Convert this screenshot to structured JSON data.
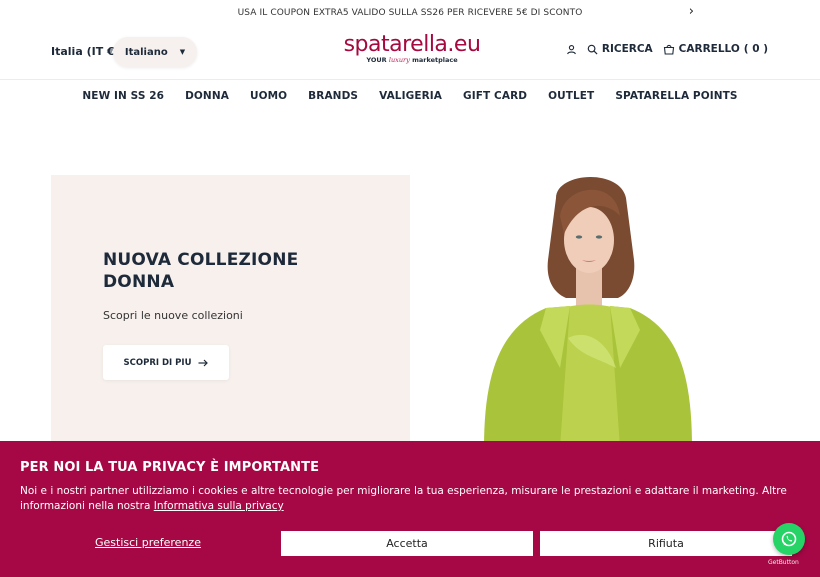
{
  "announcement": {
    "text": "USA IL COUPON EXTRA5 VALIDO SULLA SS26 PER RICEVERE 5€ DI SCONTO"
  },
  "header": {
    "locale": "Italia (IT €)",
    "language": "Italiano",
    "logo_main": "spatarella.eu",
    "logo_sub_prefix": "YOUR",
    "logo_sub_script": "luxury",
    "logo_sub_suffix": "marketplace",
    "search_label": "RICERCA",
    "cart_label": "CARRELLO",
    "cart_count": "( 0 )"
  },
  "nav": {
    "items": [
      "NEW IN SS 26",
      "DONNA",
      "UOMO",
      "BRANDS",
      "VALIGERIA",
      "GIFT CARD",
      "OUTLET",
      "SPATARELLA POINTS"
    ]
  },
  "hero": {
    "title_line1": "NUOVA COLLEZIONE",
    "title_line2": "DONNA",
    "subtitle": "Scopri le nuove collezioni",
    "cta": "SCOPRI DI PIU"
  },
  "cookie": {
    "title": "PER NOI LA TUA PRIVACY È IMPORTANTE",
    "text": "Noi e i nostri partner utilizziamo i cookies e altre tecnologie per migliorare la tua esperienza, misurare le prestazioni e adattare il marketing. Altre informazioni nella nostra ",
    "link": "Informativa sulla privacy",
    "manage": "Gestisci preferenze",
    "accept": "Accetta",
    "reject": "Rifiuta"
  },
  "whatsapp": {
    "label": "GetButton"
  },
  "colors": {
    "brand": "#a50845",
    "navy": "#1e2a3a",
    "card_bg": "#f7f0ed",
    "jacket": "#b6cf4a"
  }
}
